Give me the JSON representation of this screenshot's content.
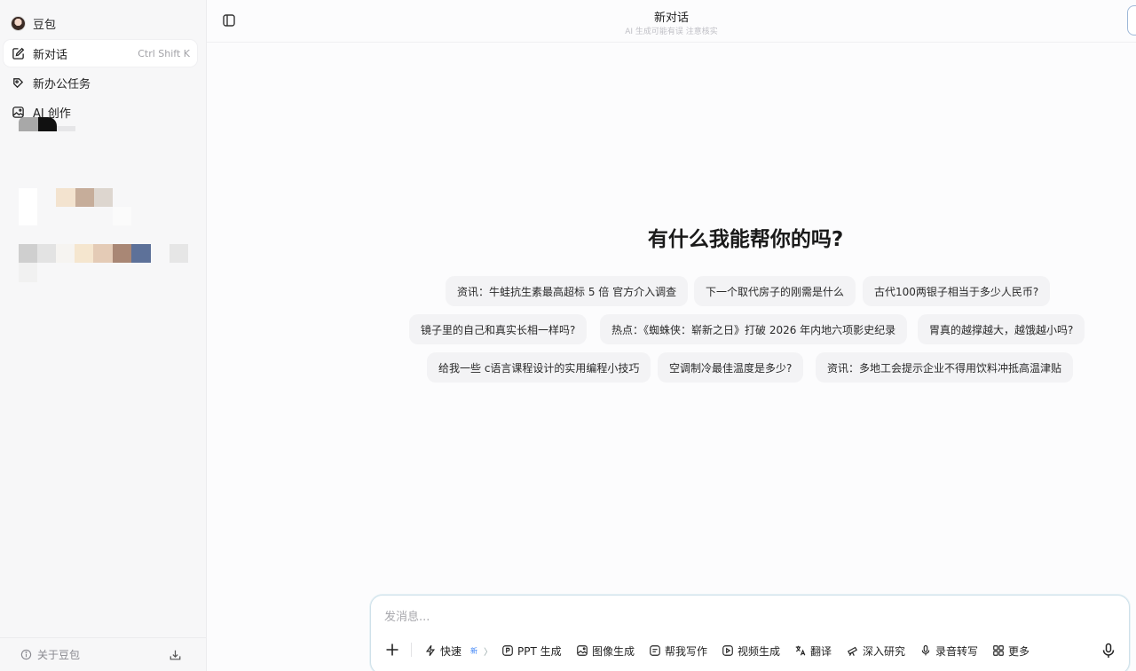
{
  "app": {
    "name": "豆包"
  },
  "sidebar": {
    "items": [
      {
        "label": "新对话",
        "shortcut": "Ctrl Shift K"
      },
      {
        "label": "新办公任务"
      },
      {
        "label": "AI 创作"
      }
    ],
    "footer": {
      "about": "关于豆包"
    }
  },
  "header": {
    "title": "新对话",
    "subtitle": "AI 生成可能有误 注意核实"
  },
  "main": {
    "heading": "有什么我能帮你的吗?",
    "suggestions": [
      "资讯：牛蛙抗生素最高超标 5 倍 官方介入调查",
      "下一个取代房子的刚需是什么",
      "古代100两银子相当于多少人民币?",
      "镜子里的自己和真实长相一样吗?",
      "热点：《蜘蛛侠：崭新之日》打破 2026 年内地六项影史纪录",
      "胃真的越撑越大，越饿越小吗?",
      "给我一些 c语言课程设计的实用编程小技巧",
      "空调制冷最佳温度是多少?",
      "资讯：多地工会提示企业不得用饮料冲抵高温津贴"
    ]
  },
  "composer": {
    "placeholder": "发消息...",
    "tools": {
      "fast": "快速",
      "fast_badge": "新",
      "ppt": "PPT 生成",
      "image": "图像生成",
      "writing": "帮我写作",
      "video": "视频生成",
      "translate": "翻译",
      "research": "深入研究",
      "transcribe": "录音转写",
      "more": "更多"
    }
  }
}
